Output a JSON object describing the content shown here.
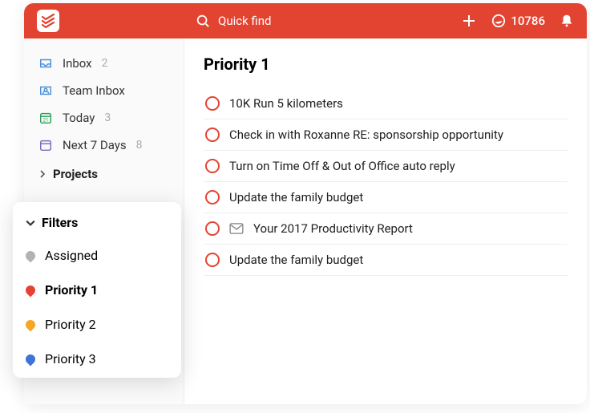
{
  "header": {
    "search_placeholder": "Quick find",
    "karma_points": "10786"
  },
  "sidebar": {
    "items": [
      {
        "label": "Inbox",
        "count": "2"
      },
      {
        "label": "Team Inbox",
        "count": ""
      },
      {
        "label": "Today",
        "count": "3"
      },
      {
        "label": "Next 7 Days",
        "count": "8"
      }
    ],
    "projects_label": "Projects"
  },
  "filters": {
    "heading": "Filters",
    "items": [
      {
        "label": "Assigned"
      },
      {
        "label": "Priority 1"
      },
      {
        "label": "Priority 2"
      },
      {
        "label": "Priority 3"
      }
    ]
  },
  "main": {
    "title": "Priority 1",
    "tasks": [
      {
        "title": "10K Run 5 kilometers",
        "has_mail": false
      },
      {
        "title": "Check in with Roxanne RE: sponsorship opportunity",
        "has_mail": false
      },
      {
        "title": "Turn on Time Off & Out of Office auto reply",
        "has_mail": false
      },
      {
        "title": "Update the family budget",
        "has_mail": false
      },
      {
        "title": "Your 2017 Productivity Report",
        "has_mail": true
      },
      {
        "title": "Update the family budget",
        "has_mail": false
      }
    ]
  }
}
